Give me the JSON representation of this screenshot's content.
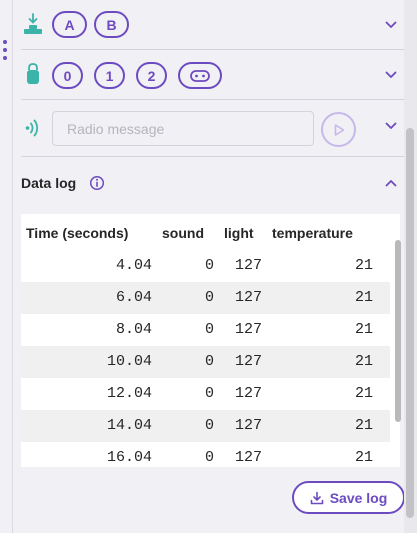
{
  "controls": {
    "buttons": {
      "icon": "button-press-icon",
      "items": [
        "A",
        "B"
      ]
    },
    "pins": {
      "icon": "pin-icon",
      "items": [
        "0",
        "1",
        "2"
      ],
      "logo_icon": "microbit-logo-icon"
    },
    "radio": {
      "icon": "radio-wave-icon",
      "placeholder": "Radio message",
      "send_icon": "play-icon"
    }
  },
  "data_log": {
    "title": "Data log",
    "info_icon": "info-icon",
    "columns": [
      "Time (seconds)",
      "sound",
      "light",
      "temperature"
    ],
    "rows": [
      [
        "4.04",
        "0",
        "127",
        "21"
      ],
      [
        "6.04",
        "0",
        "127",
        "21"
      ],
      [
        "8.04",
        "0",
        "127",
        "21"
      ],
      [
        "10.04",
        "0",
        "127",
        "21"
      ],
      [
        "12.04",
        "0",
        "127",
        "21"
      ],
      [
        "14.04",
        "0",
        "127",
        "21"
      ],
      [
        "16.04",
        "0",
        "127",
        "21"
      ]
    ],
    "save_label": "Save log"
  },
  "colors": {
    "accent": "#6c4bc1",
    "icon_teal": "#3cb3a8",
    "background": "#f1f0f4"
  }
}
